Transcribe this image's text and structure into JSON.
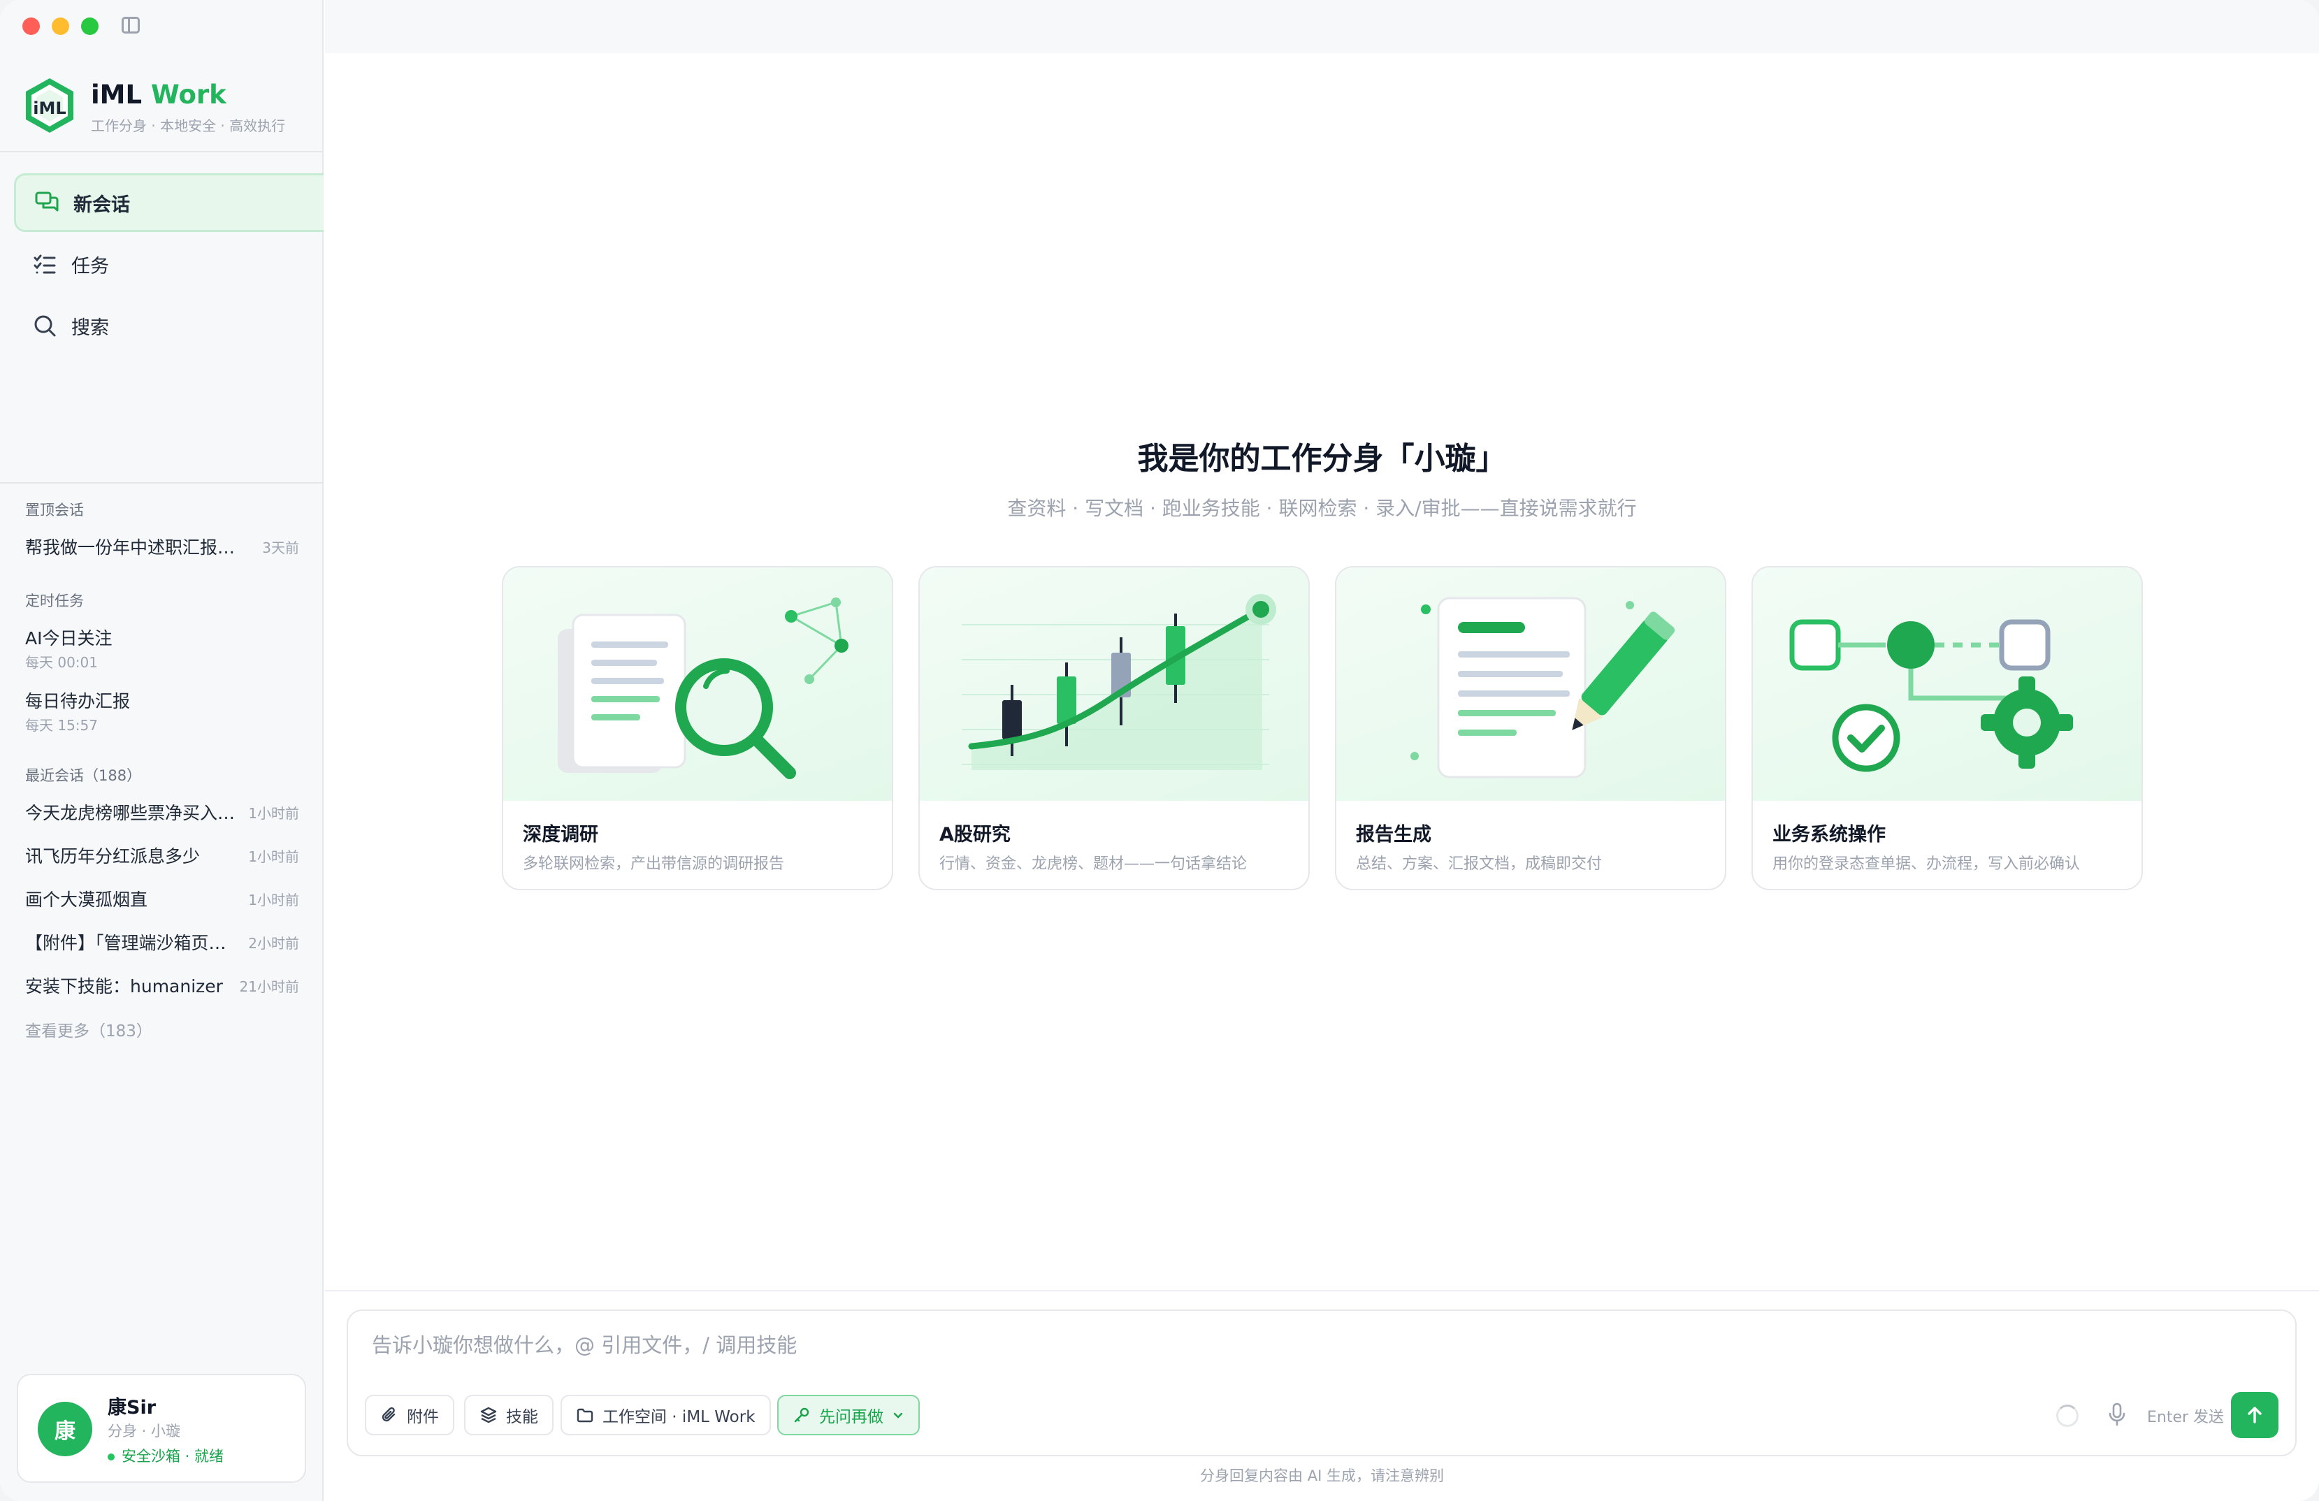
{
  "brand": {
    "name_main": "iML",
    "name_accent": "Work",
    "tagline": "工作分身 · 本地安全 · 高效执行"
  },
  "nav": [
    {
      "label": "新会话",
      "icon": "chat-bubbles-icon",
      "active": true
    },
    {
      "label": "任务",
      "icon": "checklist-icon",
      "active": false
    },
    {
      "label": "搜索",
      "icon": "search-icon",
      "active": false
    }
  ],
  "pinned": {
    "heading": "置顶会话",
    "items": [
      {
        "title": "帮我做一份年中述职汇报PPT",
        "time": "3天前"
      }
    ]
  },
  "scheduled": {
    "heading": "定时任务",
    "items": [
      {
        "title": "AI今日关注",
        "schedule": "每天 00:01"
      },
      {
        "title": "每日待办汇报",
        "schedule": "每天 15:57"
      }
    ]
  },
  "recent": {
    "heading": "最近会话（188）",
    "items": [
      {
        "title": "今天龙虎榜哪些票净买入最多",
        "time": "1小时前"
      },
      {
        "title": "讯飞历年分红派息多少",
        "time": "1小时前"
      },
      {
        "title": "画个大漠孤烟直",
        "time": "1小时前"
      },
      {
        "title": "【附件】「管理端沙箱页面」分析",
        "time": "2小时前"
      },
      {
        "title": "安装下技能：humanizer",
        "time": "21小时前"
      }
    ],
    "more": "查看更多（183）"
  },
  "user": {
    "avatar": "康",
    "name": "康Sir",
    "role": "分身 · 小璇",
    "status": "安全沙箱 · 就绪"
  },
  "hero": {
    "title": "我是你的工作分身「小璇」",
    "subtitle": "查资料 · 写文档 · 跑业务技能 · 联网检索 · 录入/审批——直接说需求就行"
  },
  "cards": [
    {
      "title": "深度调研",
      "desc": "多轮联网检索，产出带信源的调研报告"
    },
    {
      "title": "A股研究",
      "desc": "行情、资金、龙虎榜、题材——一句话拿结论"
    },
    {
      "title": "报告生成",
      "desc": "总结、方案、汇报文档，成稿即交付"
    },
    {
      "title": "业务系统操作",
      "desc": "用你的登录态查单据、办流程，写入前必确认"
    }
  ],
  "composer": {
    "placeholder": "告诉小璇你想做什么，@ 引用文件，/ 调用技能",
    "attach": "附件",
    "skills": "技能",
    "workspace": "工作空间 · iML Work",
    "mode": "先问再做",
    "enter_hint": "Enter 发送"
  },
  "disclaimer": "分身回复内容由 AI 生成，请注意辨别",
  "colors": {
    "accent": "#22b55e",
    "accent_light": "#e7f7ec",
    "text": "#111827",
    "muted": "#9ca3af"
  }
}
